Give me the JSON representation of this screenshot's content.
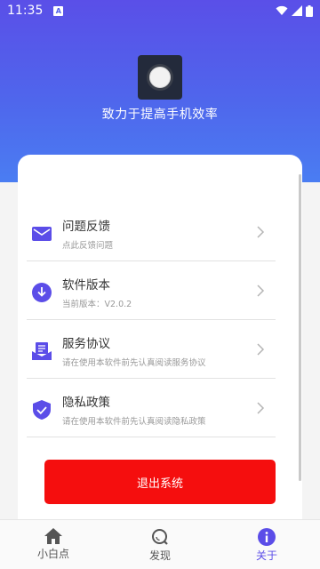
{
  "status_bar": {
    "time": "11:35",
    "notification_badge": "A"
  },
  "header": {
    "slogan": "致力于提高手机效率"
  },
  "menu": [
    {
      "title": "问题反馈",
      "subtitle": "点此反馈问题",
      "icon": "mail-icon"
    },
    {
      "title": "软件版本",
      "subtitle": "当前版本：V2.0.2",
      "icon": "download-icon"
    },
    {
      "title": "服务协议",
      "subtitle": "请在使用本软件前先认真阅读服务协议",
      "icon": "agreement-icon"
    },
    {
      "title": "隐私政策",
      "subtitle": "请在使用本软件前先认真阅读隐私政策",
      "icon": "shield-check-icon"
    }
  ],
  "logout_label": "退出系统",
  "tabs": [
    {
      "label": "小白点",
      "icon": "home-icon"
    },
    {
      "label": "发现",
      "icon": "discover-icon"
    },
    {
      "label": "关于",
      "icon": "info-icon"
    }
  ],
  "colors": {
    "accent": "#5b4de8",
    "logout": "#f50e0e",
    "hero_top": "#5a4fe8",
    "hero_bottom": "#4a7df2"
  }
}
